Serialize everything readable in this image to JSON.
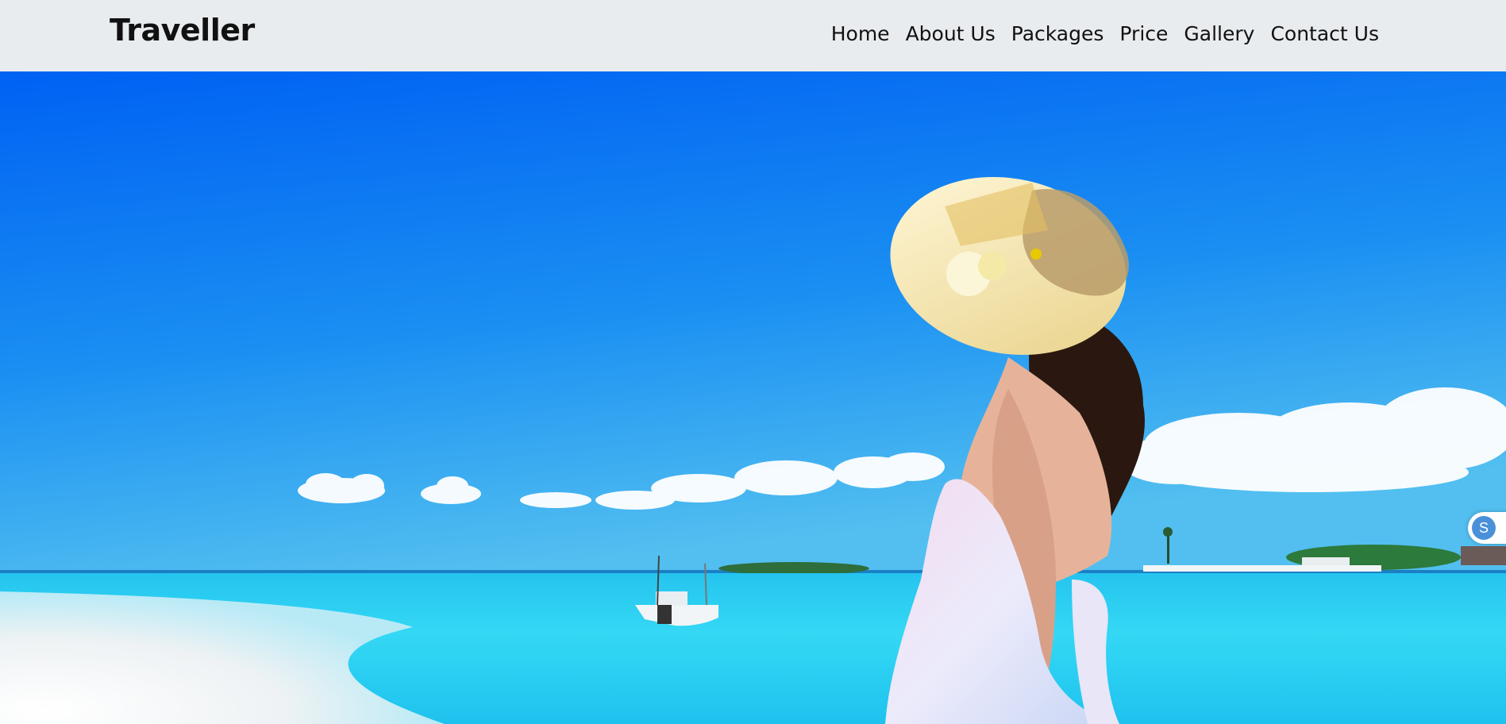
{
  "brand": {
    "name": "Traveller"
  },
  "nav": {
    "items": [
      {
        "label": "Home"
      },
      {
        "label": "About Us"
      },
      {
        "label": "Packages"
      },
      {
        "label": "Price"
      },
      {
        "label": "Gallery"
      },
      {
        "label": "Contact Us"
      }
    ]
  },
  "widget": {
    "icon_letter": "S"
  },
  "colors": {
    "navbar_bg": "#e9ecef",
    "sky_top": "#0066f5",
    "sky_bottom": "#3fb4ee",
    "sea": "#2fd3f0",
    "sand": "#f4f6f8"
  }
}
